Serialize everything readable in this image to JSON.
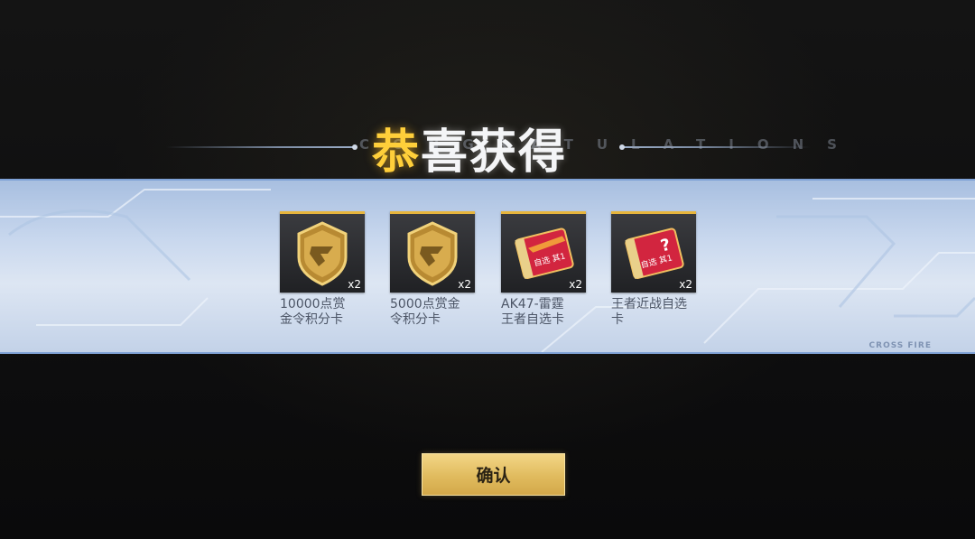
{
  "dialog": {
    "title_highlight": "恭",
    "title_rest": "喜获得",
    "title_ghost": "CONGRATULATIONS",
    "brand": "CROSS FIRE"
  },
  "rewards": [
    {
      "name": "10000点赏金令积分卡",
      "name_line1": "10000点赏",
      "name_line2": "金令积分卡",
      "count": "x2",
      "icon": "gold-badge-icon"
    },
    {
      "name": "5000点赏金令积分卡",
      "name_line1": "5000点赏金",
      "name_line2": "令积分卡",
      "count": "x2",
      "icon": "gold-badge-icon"
    },
    {
      "name": "AK47-雷霆王者自选卡",
      "name_line1": "AK47-雷霆",
      "name_line2": "王者自选卡",
      "count": "x2",
      "icon": "weapon-select-card-icon",
      "card_text": "自选 其1"
    },
    {
      "name": "王者近战自选卡",
      "name_line1": "王者近战自选",
      "name_line2": "卡",
      "count": "x2",
      "icon": "mystery-select-card-icon",
      "card_text": "自选 其1",
      "card_mark": "?"
    }
  ],
  "confirm_label": "确认",
  "colors": {
    "accent_gold": "#e7b53c",
    "title_highlight": "#ffcf3a",
    "banner": "#c9d8ee",
    "card_red": "#d2253f"
  }
}
